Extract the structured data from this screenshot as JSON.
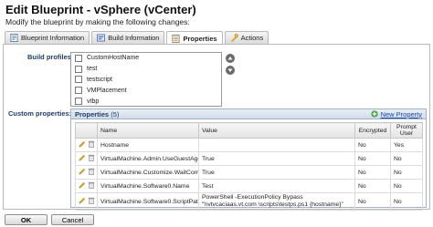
{
  "header": {
    "title": "Edit Blueprint - vSphere (vCenter)",
    "subtitle": "Modify the blueprint by making the following changes:"
  },
  "tabs": [
    {
      "label": "Blueprint Information",
      "icon": "info-icon",
      "active": false
    },
    {
      "label": "Build Information",
      "icon": "build-icon",
      "active": false
    },
    {
      "label": "Properties",
      "icon": "properties-icon",
      "active": true
    },
    {
      "label": "Actions",
      "icon": "actions-icon",
      "active": false
    }
  ],
  "build_profiles": {
    "label": "Build profiles:",
    "items": [
      "CustomHostName",
      "test",
      "testscript",
      "VMPlacement",
      "vtbp"
    ]
  },
  "custom_properties": {
    "label": "Custom properties:",
    "panel_title": "Properties",
    "count": "(5)",
    "new_property_label": "New Property",
    "columns": {
      "name": "Name",
      "value": "Value",
      "encrypted": "Encrypted",
      "prompt": "Prompt User"
    },
    "rows": [
      {
        "name": "Hostname",
        "value": "",
        "encrypted": "No",
        "prompt": "Yes"
      },
      {
        "name": "VirtualMachine.Admin.UseGuestAgent",
        "value": "True",
        "encrypted": "No",
        "prompt": "No"
      },
      {
        "name": "VirtualMachine.Customize.WaitComplete",
        "value": "True",
        "encrypted": "No",
        "prompt": "No"
      },
      {
        "name": "VirtualMachine.Software0.Name",
        "value": "Test",
        "encrypted": "No",
        "prompt": "No"
      },
      {
        "name": "VirtualMachine.Software0.ScriptPath",
        "value": "PowerShell -ExecutionPolicy Bypass \"\\\\vtvcaciaas.vt.com \\scripts\\testps.ps1 {hostname}\"",
        "encrypted": "No",
        "prompt": "No"
      }
    ]
  },
  "footer": {
    "ok_label": "OK",
    "cancel_label": "Cancel"
  },
  "colors": {
    "label_blue": "#1d3d6b",
    "link_blue": "#1a4aa5",
    "panel_border": "#9fb3cc"
  }
}
